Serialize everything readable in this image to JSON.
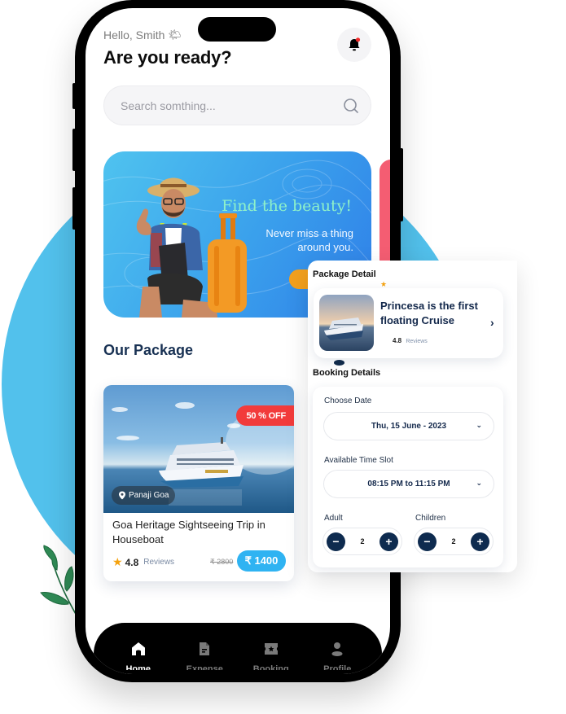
{
  "header": {
    "greeting": "Hello, Smith",
    "greeting_emoji": "🌤",
    "title": "Are you ready?",
    "notification_icon": "bell-icon",
    "has_unread": true
  },
  "search": {
    "placeholder": "Search somthing...",
    "value": "",
    "icon": "search-icon"
  },
  "banner": {
    "headline": "Find the beauty!",
    "subtitle": "Never miss a thing around you.",
    "cta_color": "#f2a01e",
    "next_banner_color": "#f45d72"
  },
  "section": {
    "title": "Our Package"
  },
  "package_card": {
    "discount": "50 % OFF",
    "location": "Panaji Goa",
    "title": "Goa Heritage Sightseeing Trip in Houseboat",
    "rating": "4.8",
    "reviews_label": "Reviews",
    "old_price": "₹ 2800",
    "price": "₹ 1400"
  },
  "bottom_nav": {
    "items": [
      {
        "label": "Home",
        "icon": "home-icon",
        "active": true
      },
      {
        "label": "Expense",
        "icon": "document-icon",
        "active": false
      },
      {
        "label": "Booking",
        "icon": "ticket-icon",
        "active": false
      },
      {
        "label": "Profile",
        "icon": "user-icon",
        "active": false
      }
    ]
  },
  "panel": {
    "package_heading": "Package Detail",
    "package_title": "Princesa is the first floating Cruise",
    "package_rating": "4.8",
    "package_reviews_label": "Reviews",
    "booking_heading": "Booking Details",
    "date_label": "Choose Date",
    "date_value": "Thu, 15 June - 2023",
    "slot_label": "Available Time Slot",
    "slot_value": "08:15 PM to 11:15 PM",
    "adult_label": "Adult",
    "adult_count": "2",
    "children_label": "Children",
    "children_count": "2",
    "minus": "−",
    "plus": "+"
  },
  "colors": {
    "accent_blue": "#2fb3f2",
    "navy": "#0e2b4f",
    "discount_red": "#f23b3b",
    "background_circle": "#52c1ec",
    "star": "#f5a20e"
  }
}
